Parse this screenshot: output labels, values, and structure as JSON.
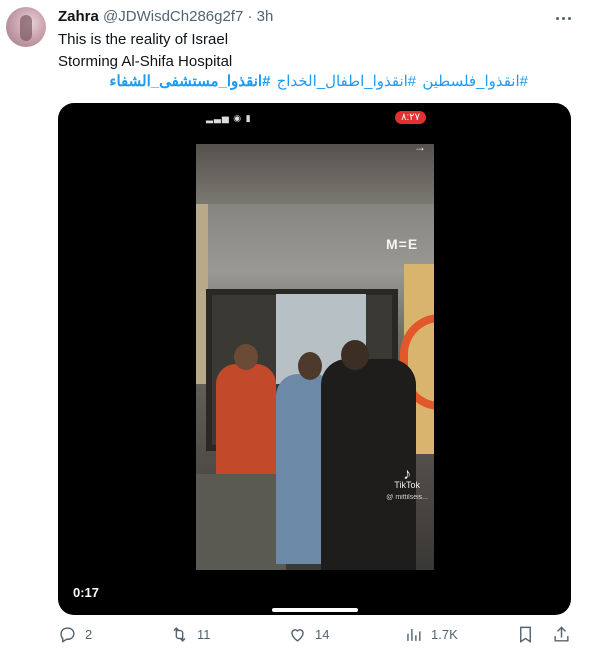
{
  "tweet": {
    "author_name": "Zahra",
    "author_handle": "@JDWisdCh286g2f7",
    "separator": "·",
    "time": "3h",
    "text_line1": "This is the reality of Israel",
    "text_line2": "Storming Al-Shifa Hospital",
    "hashtags": [
      "#انقذوا_فلسطين",
      "#انقذوا_اطفال_الخداج",
      "#انقذوا_مستشفى_الشفاء"
    ]
  },
  "media": {
    "status_clock": "٨:٢٧",
    "signal_glyphs": "▂▃▅ ◉ ▮",
    "watermark": "M=E",
    "tiktok_label": "TikTok",
    "tiktok_user": "@ mittilseis...",
    "duration": "0:17"
  },
  "actions": {
    "replies": "2",
    "retweets": "11",
    "likes": "14",
    "views": "1.7K"
  }
}
